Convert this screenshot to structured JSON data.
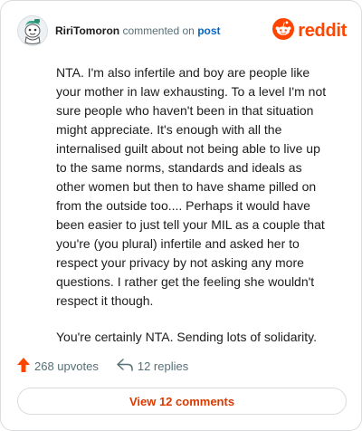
{
  "header": {
    "username": "RiriTomoron",
    "action": "commented on",
    "target": "post",
    "brand": "reddit"
  },
  "comment": {
    "paragraphs": [
      "NTA. I'm also infertile and boy are people like your mother in law exhausting. To a level I'm not sure people who haven't been in that situation might appreciate. It's enough with all the internalised guilt about not being able to live up to the same norms, standards and ideals as other women but then to have shame pilled on from the outside too.... Perhaps it would have been easier to just tell your MIL as a couple that you're (you plural) infertile and asked her to respect your privacy by not asking any more questions. I rather get the feeling she wouldn't respect it though.",
      "You're certainly NTA. Sending lots of solidarity."
    ]
  },
  "actions": {
    "upvotes": "268 upvotes",
    "replies": "12 replies"
  },
  "view_comments_label": "View 12 comments",
  "colors": {
    "brand": "#ff4500",
    "link": "#0a66c2",
    "button_text": "#d93a00"
  },
  "icons": {
    "upvote": "upvote-arrow-icon",
    "reply": "reply-arrow-icon",
    "brand": "reddit-snoo-icon",
    "avatar": "snoo-avatar"
  }
}
